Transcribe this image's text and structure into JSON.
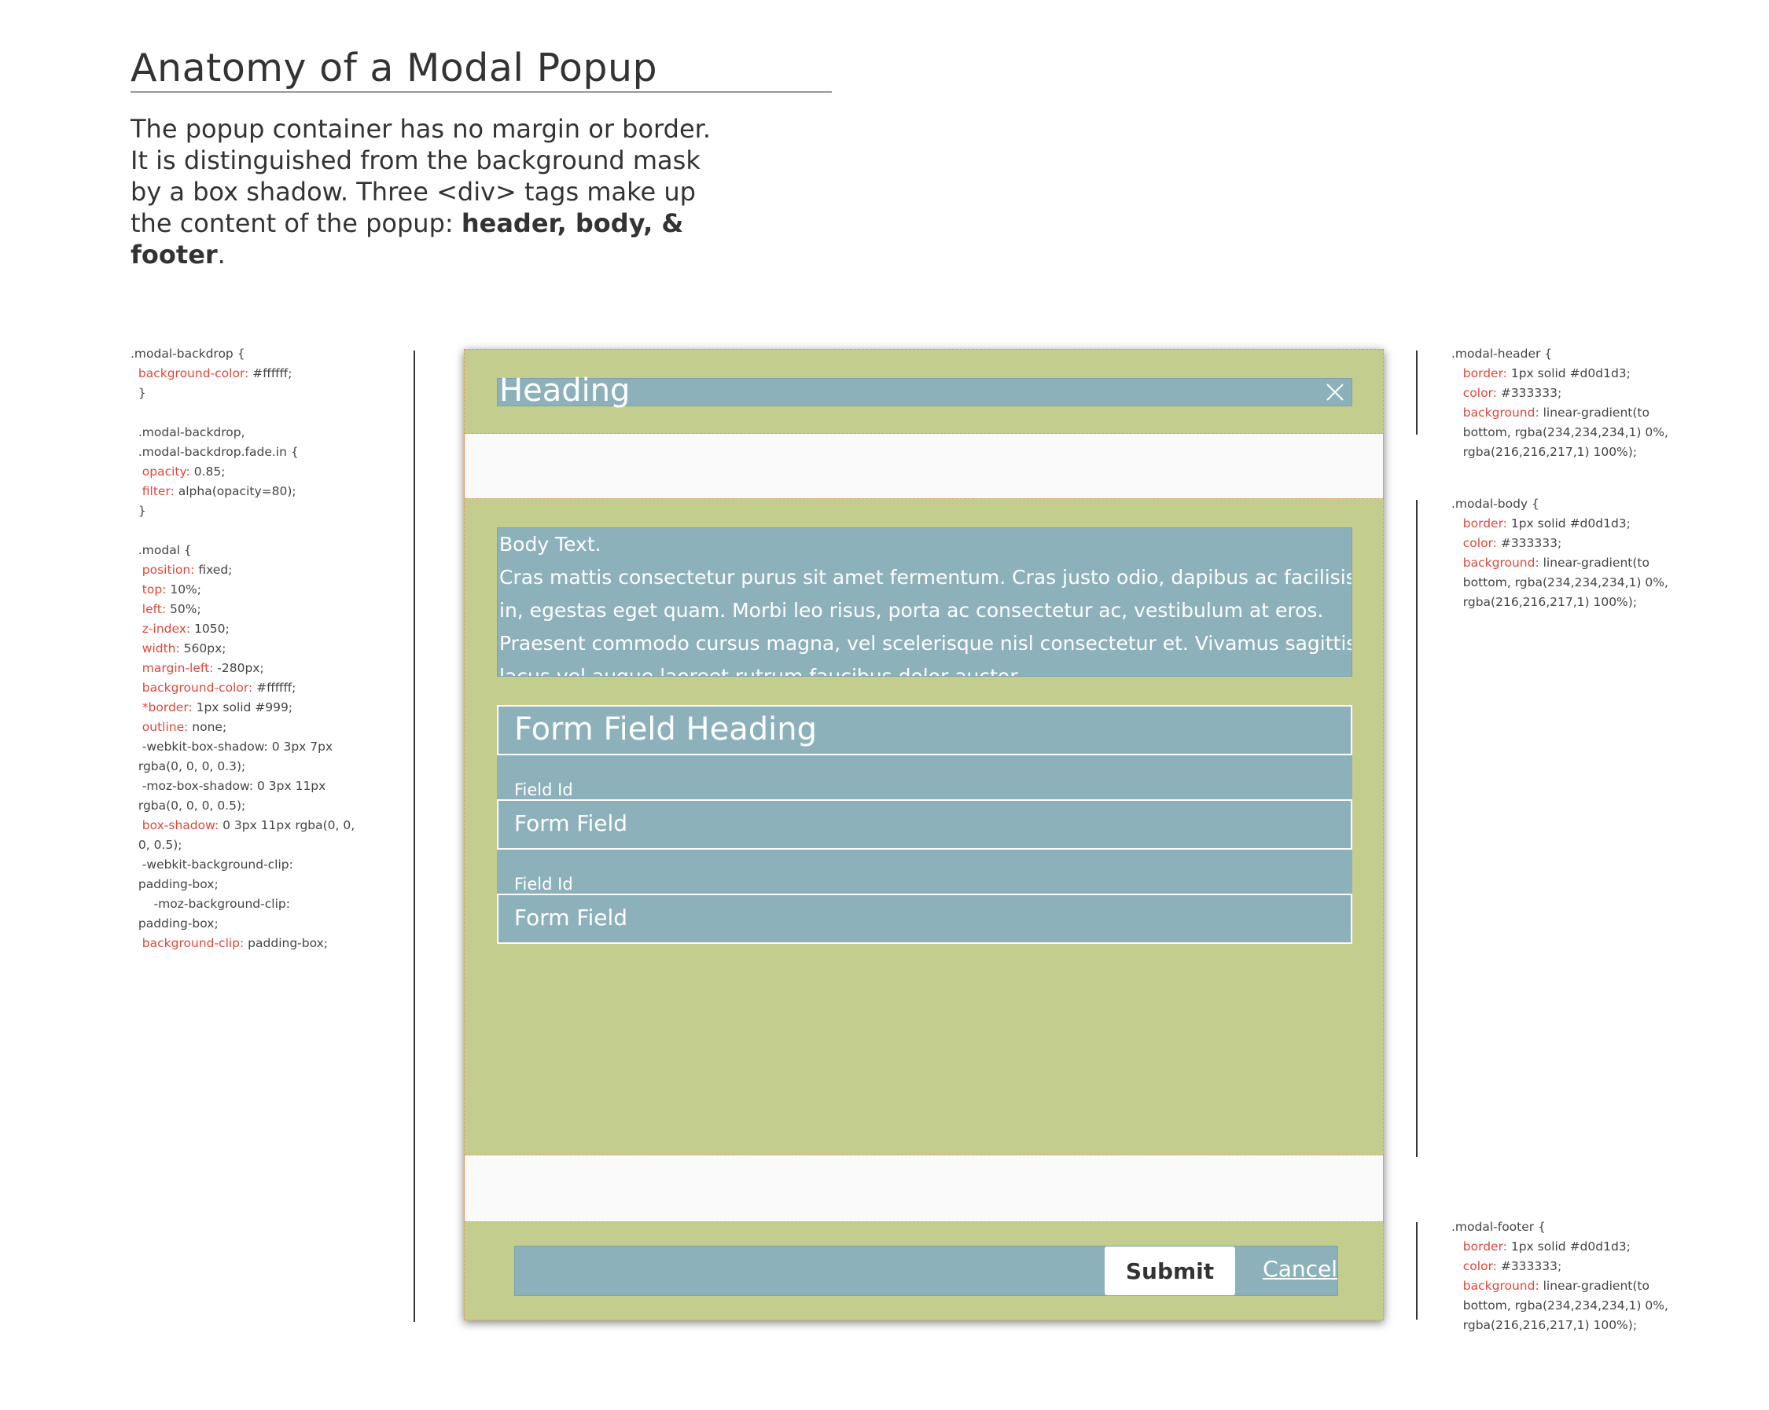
{
  "title": "Anatomy of a Modal Popup",
  "intro": {
    "text": "The popup container has no margin or border. It is distinguished from the background mask by a box shadow. Three <div> tags make up the content of the popup: ",
    "bold": "header, body, & footer",
    "end": "."
  },
  "code_left": [
    {
      "a": ".modal-backdrop {",
      "p": "",
      "v": ""
    },
    {
      "a": "  ",
      "p": "background-color:",
      "v": " #ffffff;"
    },
    {
      "a": "  }",
      "p": "",
      "v": ""
    },
    {
      "a": "",
      "p": "",
      "v": ""
    },
    {
      "a": "  .modal-backdrop,",
      "p": "",
      "v": ""
    },
    {
      "a": "  .modal-backdrop.fade.in {",
      "p": "",
      "v": ""
    },
    {
      "a": "   ",
      "p": "opacity:",
      "v": " 0.85;"
    },
    {
      "a": "   ",
      "p": "filter:",
      "v": " alpha(opacity=80);"
    },
    {
      "a": "  }",
      "p": "",
      "v": ""
    },
    {
      "a": "",
      "p": "",
      "v": ""
    },
    {
      "a": "  .modal {",
      "p": "",
      "v": ""
    },
    {
      "a": "   ",
      "p": "position:",
      "v": " fixed;"
    },
    {
      "a": "   ",
      "p": "top:",
      "v": " 10%;"
    },
    {
      "a": "   ",
      "p": "left:",
      "v": " 50%;"
    },
    {
      "a": "   ",
      "p": "z-index:",
      "v": " 1050;"
    },
    {
      "a": "   ",
      "p": "width:",
      "v": " 560px;"
    },
    {
      "a": "   ",
      "p": "margin-left:",
      "v": " -280px;"
    },
    {
      "a": "   ",
      "p": "background-color:",
      "v": " #ffffff;"
    },
    {
      "a": "   ",
      "p": "*border:",
      "v": " 1px solid #999;"
    },
    {
      "a": "   ",
      "p": "outline:",
      "v": " none;"
    },
    {
      "a": "   -webkit-box-shadow: 0 3px 7px",
      "p": "",
      "v": ""
    },
    {
      "a": "  rgba(0, 0, 0, 0.3);",
      "p": "",
      "v": ""
    },
    {
      "a": "   -moz-box-shadow: 0 3px 11px",
      "p": "",
      "v": ""
    },
    {
      "a": "  rgba(0, 0, 0, 0.5);",
      "p": "",
      "v": ""
    },
    {
      "a": "   ",
      "p": "box-shadow:",
      "v": " 0 3px 11px rgba(0, 0,"
    },
    {
      "a": "  0, 0.5);",
      "p": "",
      "v": ""
    },
    {
      "a": "   -webkit-background-clip:",
      "p": "",
      "v": ""
    },
    {
      "a": "  padding-box;",
      "p": "",
      "v": ""
    },
    {
      "a": "      -moz-background-clip:",
      "p": "",
      "v": ""
    },
    {
      "a": "  padding-box;",
      "p": "",
      "v": ""
    },
    {
      "a": "   ",
      "p": "background-clip:",
      "v": " padding-box;"
    }
  ],
  "code_header": [
    {
      "a": ".modal-header {",
      "p": "",
      "v": ""
    },
    {
      "a": "   ",
      "p": "border:",
      "v": " 1px solid #d0d1d3;"
    },
    {
      "a": "   ",
      "p": "color:",
      "v": " #333333;"
    },
    {
      "a": "   ",
      "p": "background:",
      "v": " linear-gradient(to"
    },
    {
      "a": "   bottom, rgba(234,234,234,1) 0%,",
      "p": "",
      "v": ""
    },
    {
      "a": "   rgba(216,216,217,1) 100%);",
      "p": "",
      "v": ""
    }
  ],
  "code_body": [
    {
      "a": ".modal-body {",
      "p": "",
      "v": ""
    },
    {
      "a": "   ",
      "p": "border:",
      "v": " 1px solid #d0d1d3;"
    },
    {
      "a": "   ",
      "p": "color:",
      "v": " #333333;"
    },
    {
      "a": "   ",
      "p": "background:",
      "v": " linear-gradient(to"
    },
    {
      "a": "   bottom, rgba(234,234,234,1) 0%,",
      "p": "",
      "v": ""
    },
    {
      "a": "   rgba(216,216,217,1) 100%);",
      "p": "",
      "v": ""
    }
  ],
  "code_footer": [
    {
      "a": ".modal-footer {",
      "p": "",
      "v": ""
    },
    {
      "a": "   ",
      "p": "border:",
      "v": " 1px solid #d0d1d3;"
    },
    {
      "a": "   ",
      "p": "color:",
      "v": " #333333;"
    },
    {
      "a": "   ",
      "p": "background:",
      "v": " linear-gradient(to"
    },
    {
      "a": "   bottom, rgba(234,234,234,1) 0%,",
      "p": "",
      "v": ""
    },
    {
      "a": "   rgba(216,216,217,1) 100%);",
      "p": "",
      "v": ""
    }
  ],
  "modal": {
    "heading": "Heading",
    "close_icon": "close-icon",
    "body_text": [
      "Body Text.",
      "Cras mattis consectetur purus sit amet fermentum. Cras justo odio, dapibus ac facilisis",
      "in, egestas eget quam. Morbi leo risus, porta ac consectetur ac, vestibulum at eros.",
      "Praesent commodo cursus magna, vel scelerisque nisl consectetur et. Vivamus sagittis",
      "lacus vel augue laoreet rutrum faucibus dolor auctor."
    ],
    "form_heading": "Form Field Heading",
    "fields": [
      {
        "label": "Field Id",
        "value": "Form Field"
      },
      {
        "label": "Field Id",
        "value": "Form Field"
      }
    ],
    "submit_label": "Submit",
    "cancel_label": "Cancel"
  },
  "colors": {
    "section_bg": "#c3cd8e",
    "content_bg": "#8db1bb",
    "code_property": "#e0473a",
    "dashed_border": "#e99a5a"
  }
}
